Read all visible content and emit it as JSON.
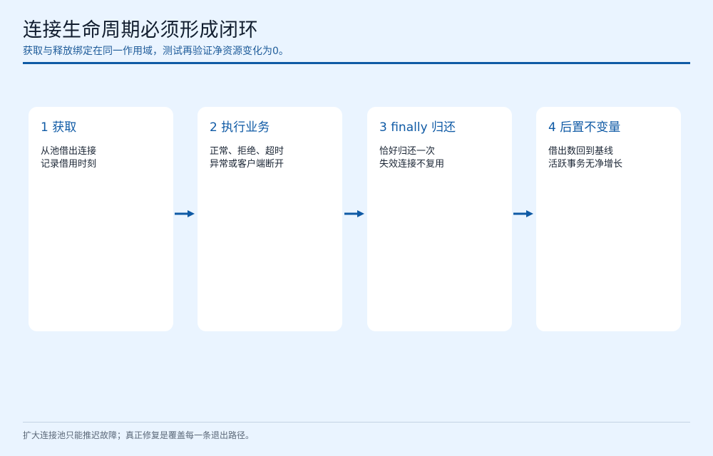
{
  "header": {
    "title": "连接生命周期必须形成闭环",
    "subtitle": "获取与释放绑定在同一作用域，测试再验证净资源变化为0。"
  },
  "steps": [
    {
      "title": "1 获取",
      "lines": [
        "从池借出连接",
        "记录借用时刻"
      ]
    },
    {
      "title": "2 执行业务",
      "lines": [
        "正常、拒绝、超时",
        "异常或客户端断开"
      ]
    },
    {
      "title": "3 finally 归还",
      "lines": [
        "恰好归还一次",
        "失效连接不复用"
      ]
    },
    {
      "title": "4 后置不变量",
      "lines": [
        "借出数回到基线",
        "活跃事务无净增长"
      ]
    }
  ],
  "footer": {
    "note": "扩大连接池只能推迟故障；真正修复是覆盖每一条退出路径。"
  },
  "colors": {
    "background": "#eaf4ff",
    "accent": "#0f5aa5",
    "card": "#ffffff"
  }
}
